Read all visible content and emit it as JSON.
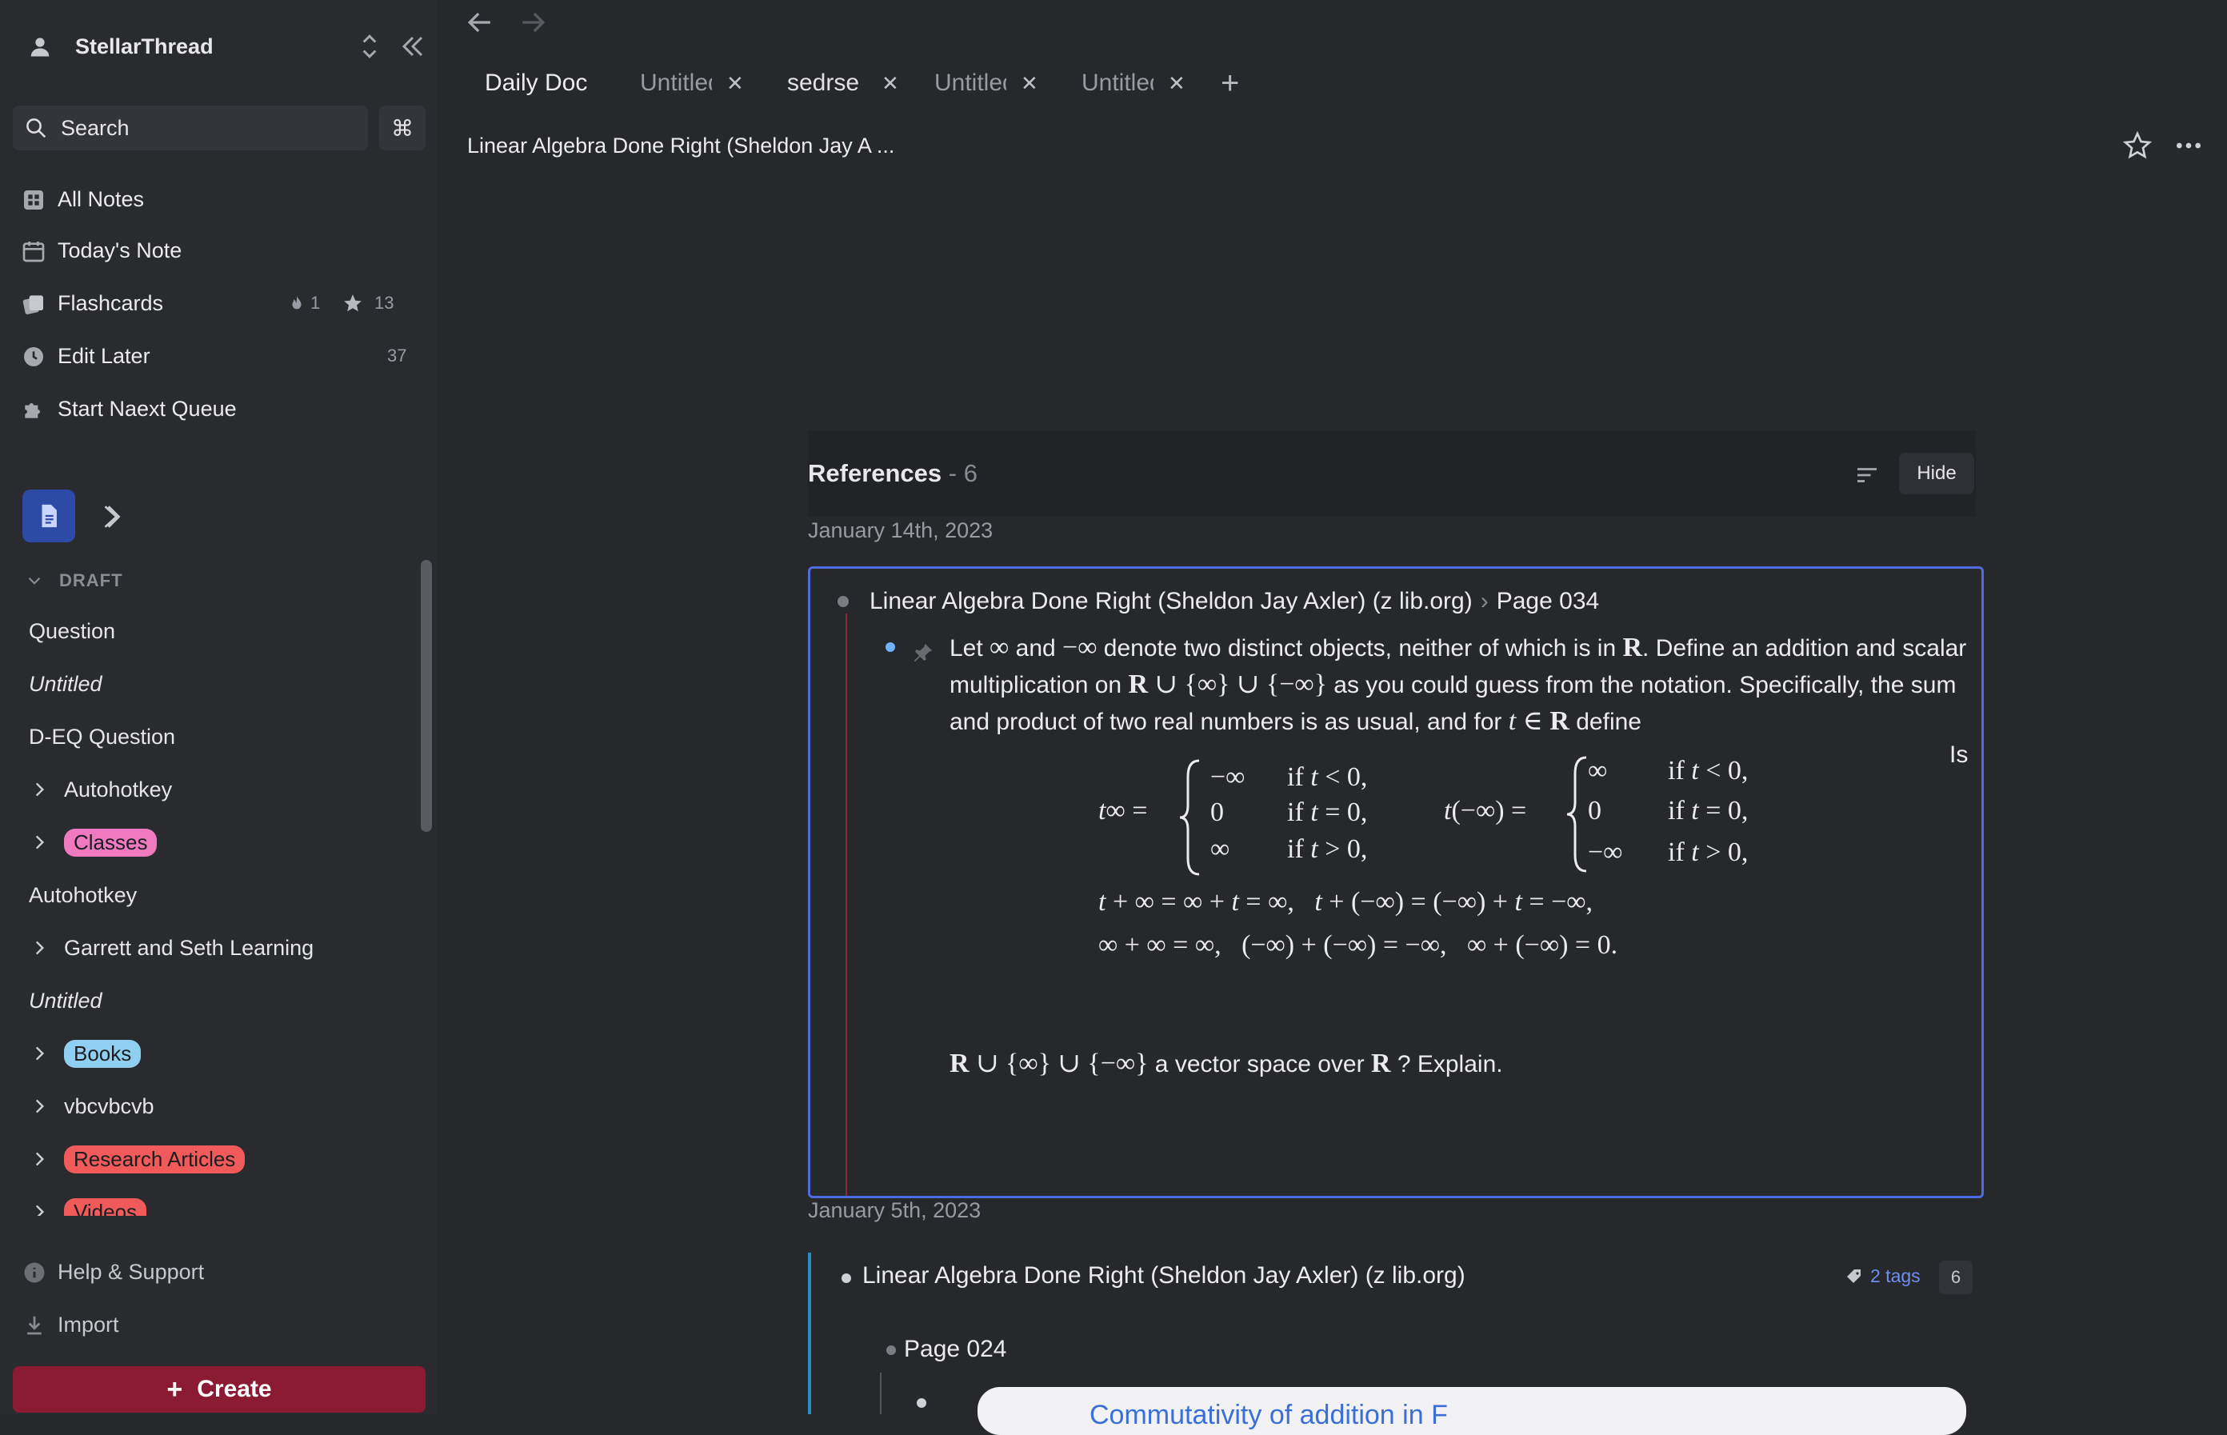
{
  "workspace": {
    "name": "StellarThread"
  },
  "search": {
    "label": "Search",
    "shortcut": "⌘"
  },
  "nav": [
    {
      "label": "All Notes"
    },
    {
      "label": "Today's Note"
    },
    {
      "label": "Flashcards",
      "count_a": "1",
      "count_b": "13"
    },
    {
      "label": "Edit Later",
      "count": "37"
    },
    {
      "label": "Start Naext Queue"
    }
  ],
  "draft": {
    "label": "DRAFT"
  },
  "tree": [
    {
      "label": "Question",
      "chev": false,
      "italic": false
    },
    {
      "label": "Untitled",
      "chev": false,
      "italic": true
    },
    {
      "label": "D-EQ Question",
      "chev": false,
      "italic": false
    },
    {
      "label": "Autohotkey",
      "chev": true,
      "italic": false
    },
    {
      "label": "Classes",
      "chev": true,
      "tag_color": "#f07ac0"
    },
    {
      "label": "Autohotkey",
      "chev": false,
      "italic": false
    },
    {
      "label": "Garrett and Seth Learning",
      "chev": true,
      "italic": false
    },
    {
      "label": "Untitled",
      "chev": false,
      "italic": true
    },
    {
      "label": "Books",
      "chev": true,
      "tag_color": "#8fd0f2"
    },
    {
      "label": "vbcvbcvb",
      "chev": true,
      "italic": false
    },
    {
      "label": "Research Articles",
      "chev": true,
      "tag_color": "#f05a5a"
    },
    {
      "label": "Videos",
      "chev": true,
      "tag_color": "#f05a5a"
    }
  ],
  "bottom": {
    "help": "Help & Support",
    "import": "Import",
    "create": "Create"
  },
  "tabs": [
    {
      "label": "Daily Doc",
      "active": true
    },
    {
      "label": "Untitled",
      "active": false
    },
    {
      "label": "sedrse",
      "active": false
    },
    {
      "label": "Untitled",
      "active": false
    },
    {
      "label": "Untitled",
      "active": false
    }
  ],
  "breadcrumb": "Linear Algebra Done Right (Sheldon Jay A ...",
  "references": {
    "title": "References",
    "count": "6",
    "hide": "Hide"
  },
  "entry1": {
    "date": "January 14th, 2023",
    "source": "Linear Algebra Done Right (Sheldon Jay Axler) (z lib.org)",
    "page": "Page 034",
    "p1a": "Let ",
    "p1b": " and ",
    "p1c": " denote two distinct objects, neither of which is in ",
    "p1d": ". Define an addition and scalar multiplication on ",
    "p1e": " as you could guess from the notation. Specifically, the sum and product of two real numbers is as usual, and for ",
    "p1f": " define",
    "is": "Is",
    "question_tail": " a vector space over ",
    "question_end": " ? Explain."
  },
  "entry2": {
    "date": "January 5th, 2023",
    "source": "Linear Algebra Done Right (Sheldon Jay Axler) (z lib.org)",
    "tags": "2 tags",
    "count": "6",
    "page": "Page 024",
    "card_text": "Commutativity of addition in F"
  },
  "colors": {
    "accent": "#4e6ce0",
    "create": "#8b1a33",
    "tag_link": "#6e8ef0"
  }
}
